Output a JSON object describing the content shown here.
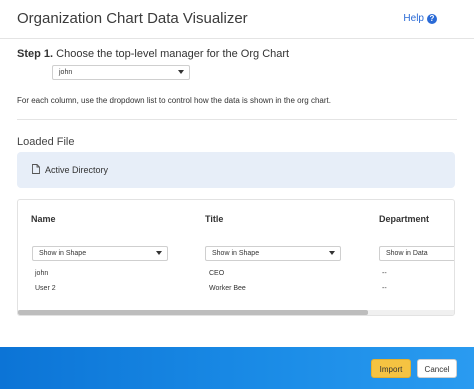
{
  "dialog": {
    "title": "Organization Chart Data Visualizer",
    "help_label": "Help",
    "help_icon": "?"
  },
  "step1": {
    "prefix": "Step 1.",
    "text": "Choose the top-level manager for the Org Chart",
    "manager_value": "john"
  },
  "instructions": "For each column, use the dropdown list to control how the data is shown in the org chart.",
  "loaded_file": {
    "label": "Loaded File",
    "name": "Active Directory"
  },
  "table": {
    "columns": [
      {
        "header": "Name",
        "mode": "Show in Shape"
      },
      {
        "header": "Title",
        "mode": "Show in Shape"
      },
      {
        "header": "Department",
        "mode": "Show in Data"
      }
    ],
    "rows": [
      [
        "john",
        "CEO",
        "--"
      ],
      [
        "User 2",
        "Worker Bee",
        "--"
      ]
    ]
  },
  "footer": {
    "import_label": "Import",
    "cancel_label": "Cancel"
  },
  "colors": {
    "accent": "#2a6ad6",
    "import_button": "#f5c342",
    "footer_gradient_start": "#0c74d6",
    "footer_gradient_end": "#2a9bf0",
    "file_box": "#e7eef8"
  }
}
